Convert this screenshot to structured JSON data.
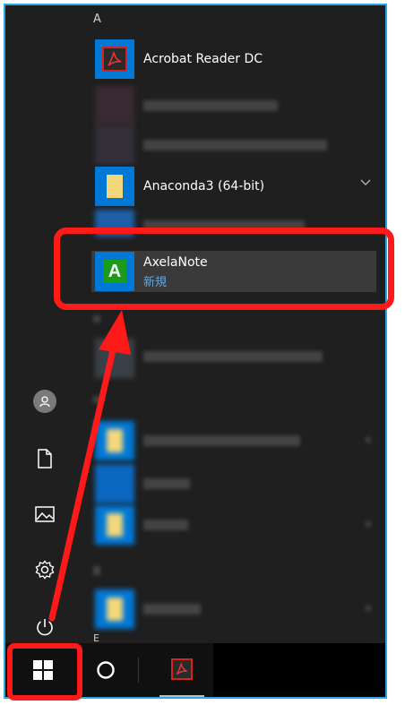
{
  "start_menu": {
    "section_a_letter": "A",
    "section_e_letter": "E",
    "apps": [
      {
        "name": "Acrobat Reader DC",
        "icon": "acrobat-icon"
      },
      {
        "name": "Anaconda3 (64-bit)",
        "icon": "folder-icon",
        "expandable": true
      },
      {
        "name": "AxelaNote",
        "subtitle": "新規",
        "icon": "axelanote-icon"
      }
    ]
  },
  "rail": {
    "icons": [
      "user-avatar-icon",
      "documents-icon",
      "pictures-icon",
      "settings-icon",
      "power-icon"
    ]
  },
  "taskbar": {
    "items": [
      "windows-start-icon",
      "cortana-search-icon",
      "acrobat-taskbar-icon"
    ]
  },
  "colors": {
    "menu_bg": "#1f1f1f",
    "highlight": "#ff1a1a",
    "accent_blue": "#0078d7",
    "new_label": "#55aaf0"
  }
}
